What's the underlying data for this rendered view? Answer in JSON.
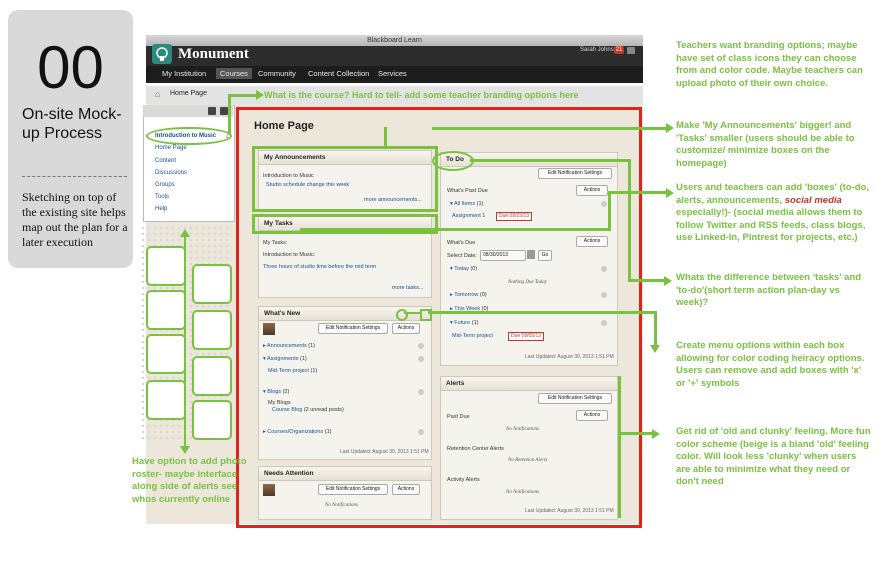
{
  "card": {
    "number": "00",
    "title": "On-site Mock-up Process",
    "description": "Sketching on top of the existing site helps map out the plan for a later execution"
  },
  "window": {
    "title": "Blackboard Learn",
    "brand": "Monument",
    "user": "Sarah Johnson",
    "badge": "21"
  },
  "nav": [
    "My Institution",
    "Courses",
    "Community",
    "Content Collection",
    "Services"
  ],
  "breadcrumb": "Home Page",
  "course_menu": {
    "course": "Introduction to Music",
    "items": [
      "Home Page",
      "Content",
      "Discussions",
      "Groups",
      "Tools",
      "Help"
    ]
  },
  "page_title": "Home Page",
  "modules": {
    "announcements": {
      "title": "My Announcements",
      "course": "Introduction to Music",
      "item": "Studio schedule change this week",
      "more": "more announcements..."
    },
    "tasks": {
      "title": "My Tasks",
      "label": "My Tasks:",
      "course": "Introduction to Music:",
      "item": "Three hours of studio time before the mid term",
      "more": "more tasks..."
    },
    "whats_new": {
      "title": "What's New",
      "notif_btn": "Edit Notification Settings",
      "actions_btn": "Actions",
      "announcements": "Announcements",
      "announcements_count": "(1)",
      "assignments": "Assignments",
      "assignments_count": "(1)",
      "assignment_item": "Mid-Term project",
      "assignment_item_count": "(1)",
      "blogs": "Blogs",
      "blogs_count": "(2)",
      "my_blogs": "My Blogs",
      "course_blog": "Course Blog",
      "course_blog_note": "(2 unread posts)",
      "courses_orgs": "Courses/Organizations",
      "courses_orgs_count": "(1)",
      "updated": "Last Updated: August 30, 2013 1:51 PM"
    },
    "needs_attention": {
      "title": "Needs Attention",
      "notif_btn": "Edit Notification Settings",
      "actions_btn": "Actions",
      "empty": "No Notifications"
    },
    "todo": {
      "title": "To Do",
      "notif_btn": "Edit Notification Settings",
      "actions_btn": "Actions",
      "past_due": "What's Past Due",
      "all_items": "All Items",
      "all_items_count": "(1)",
      "assignment": "Assignment 1",
      "assignment_due": "Due 08/23/13",
      "whats_due": "What's Due",
      "select_date": "Select Date:",
      "date_value": "08/30/2013",
      "go": "Go",
      "today": "Today",
      "today_count": "(0)",
      "nothing_due": "Nothing Due Today",
      "tomorrow": "Tomorrow",
      "tomorrow_count": "(0)",
      "this_week": "This Week",
      "this_week_count": "(0)",
      "future": "Future",
      "future_count": "(1)",
      "project": "Mid-Term project",
      "project_due": "Due 09/05/13",
      "updated": "Last Updated: August 30, 2013 1:51 PM"
    },
    "alerts": {
      "title": "Alerts",
      "notif_btn": "Edit Notification Settings",
      "actions_btn": "Actions",
      "past_due": "Past Due",
      "no_notifications": "No Notifications",
      "retention": "Retention Center Alerts",
      "no_retention": "No Retention Alerts",
      "activity": "Activity Alerts",
      "no_activity": "No Notifications",
      "updated": "Last Updated: August 30, 2013 1:51 PM"
    }
  },
  "annotations": {
    "course_id": "What is the course? Hard to tell- add some teacher branding options here",
    "branding": "Teachers want branding options; maybe have set of class icons they can choose from and color code. Maybe teachers can upload photo of their own choice.",
    "announcements": "Make 'My Announcements' bigger! and 'Tasks' smaller (users should be able to customize/ minimize boxes on the homepage)",
    "boxes_1": "Users and teachers can add 'boxes' (to-do, alerts, announcements, ",
    "boxes_social": "social media",
    "boxes_2": " especially!)- (social media allows them to follow Twitter and RSS feeds, class blogs, use Linked-In, Pintrest for projects, etc.)",
    "tasks_todo": "Whats the difference between 'tasks' and 'to-do'(short term action plan-day vs week)?",
    "menu_options": "Create menu options within each box allowing for color coding heiracy options. Users can remove and add boxes with 'x' or '+' symbols",
    "clunky": "Get rid of 'old and clunky' feeling. More fun color scheme (beige is a bland 'old' feeling color. Will look less 'clunky' when users are able to minimize what they need or don't need",
    "roster": "Have option to add photo roster- maybe interface along side of alerts see whos currently online"
  },
  "colors": {
    "annotation_green": "#7ac142",
    "frame_red": "#e0241d",
    "beige": "#ece7da"
  }
}
